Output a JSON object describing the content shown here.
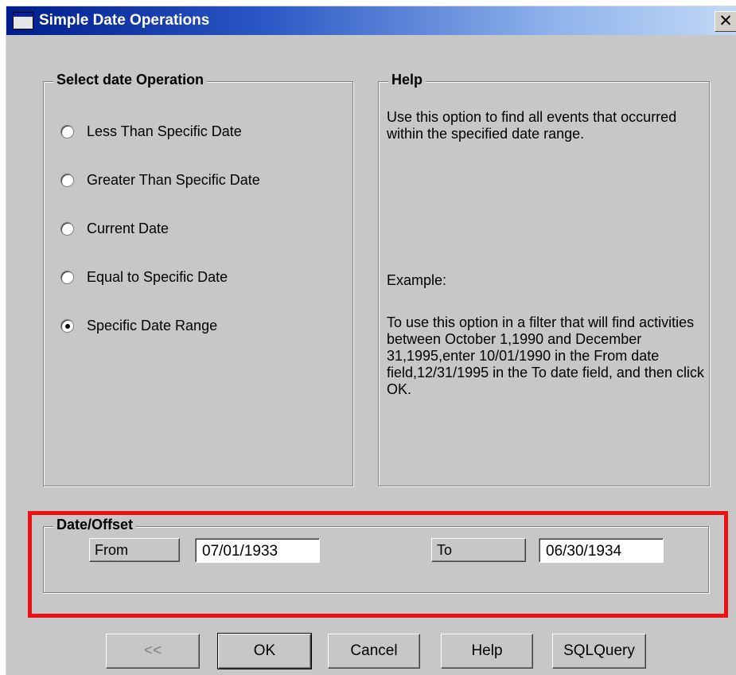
{
  "window": {
    "title": "Simple Date Operations",
    "close_glyph": "✕",
    "icon": "window-icon"
  },
  "operation_group": {
    "legend": "Select date Operation",
    "options": [
      {
        "label": "Less Than Specific Date",
        "checked": false
      },
      {
        "label": "Greater Than Specific Date",
        "checked": false
      },
      {
        "label": "Current Date",
        "checked": false
      },
      {
        "label": "Equal to Specific Date",
        "checked": false
      },
      {
        "label": "Specific Date Range",
        "checked": true
      }
    ]
  },
  "help_group": {
    "legend": "Help",
    "description": "Use this option to find all events that occurred within the specified date range.",
    "example_heading": "Example:",
    "example_text": "To use this option in a filter that will find activities between October 1,1990 and December 31,1995,enter 10/01/1990 in the From date field,12/31/1995 in the To date field, and then click OK."
  },
  "date_offset": {
    "legend": "Date/Offset",
    "from_label": "From",
    "from_value": "07/01/1933",
    "to_label": "To",
    "to_value": "06/30/1934"
  },
  "buttons": {
    "back": "<<",
    "ok": "OK",
    "cancel": "Cancel",
    "help": "Help",
    "sql_query": "SQLQuery"
  },
  "colors": {
    "dialog_bg": "#c7c7c7",
    "title_bar_start": "#001c8c",
    "title_bar_end": "#c2d8f6",
    "highlight_border": "#ee1111"
  }
}
